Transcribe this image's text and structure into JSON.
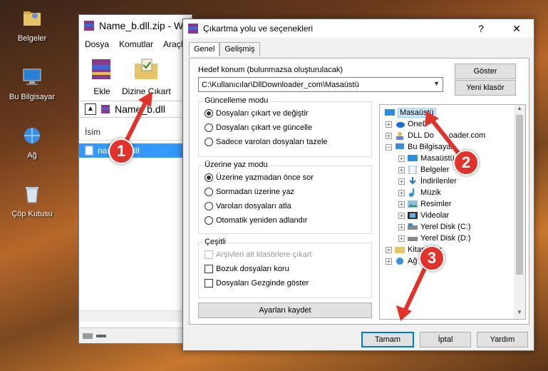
{
  "desktop": {
    "icons": [
      {
        "label": "Belgeler",
        "icon": "folder-user-icon"
      },
      {
        "label": "Bu Bilgisayar",
        "icon": "computer-icon"
      },
      {
        "label": "Ağ",
        "icon": "network-icon"
      },
      {
        "label": "Çöp Kutusu",
        "icon": "recycle-bin-icon"
      }
    ]
  },
  "winrar": {
    "title": "Name_b.dll.zip - Wi",
    "menu": [
      "Dosya",
      "Komutlar",
      "Araçla"
    ],
    "tools": {
      "add": "Ekle",
      "extract": "Dizine Çıkart"
    },
    "address": "Name_b.dll",
    "column_name": "İsim",
    "file_row": "name_b.dll"
  },
  "dialog": {
    "title": "Çıkartma yolu ve seçenekleri",
    "help_button": "?",
    "close_button": "✕",
    "tabs": [
      "Genel",
      "Gelişmiş"
    ],
    "dest_label": "Hedef konum (bulunmazsa oluşturulacak)",
    "dest_value": "C:\\Kullanıcılar\\DllDownloader_com\\Masaüstü",
    "show_button": "Göster",
    "new_folder_button": "Yeni klasör",
    "update_mode": {
      "title": "Güncelleme modu",
      "options": [
        "Dosyaları çıkart ve değiştir",
        "Dosyaları çıkart ve güncelle",
        "Sadece varolan dosyaları tazele"
      ],
      "selected": 0
    },
    "overwrite_mode": {
      "title": "Üzerine yaz modu",
      "options": [
        "Üzerine yazmadan önce sor",
        "Sormadan üzerine yaz",
        "Varolan dosyaları atla",
        "Otomatik yeniden adlandır"
      ],
      "selected": 0
    },
    "misc": {
      "title": "Çeşitli",
      "options": [
        "Arşivleri alt klasörlere çıkart",
        "Bozuk dosyaları koru",
        "Dosyaları Gezginde göster"
      ],
      "disabled": [
        true,
        false,
        false
      ]
    },
    "save_button": "Ayarları kaydet",
    "tree": [
      {
        "label": "Masaüstü",
        "icon": "desktop-icon"
      },
      {
        "label": "OneD",
        "icon": "cloud-icon"
      },
      {
        "label": "DLL Do",
        "icon": "user-icon"
      },
      {
        "label": "oader.com",
        "icon": "text-fragment"
      },
      {
        "label": "Bu Bilgisayar",
        "icon": "computer-icon"
      },
      {
        "label": "Masaüstü",
        "icon": "desktop-icon"
      },
      {
        "label": "Belgeler",
        "icon": "documents-icon"
      },
      {
        "label": "İndirilenler",
        "icon": "download-icon"
      },
      {
        "label": "Müzik",
        "icon": "music-icon"
      },
      {
        "label": "Resimler",
        "icon": "pictures-icon"
      },
      {
        "label": "Videolar",
        "icon": "video-icon"
      },
      {
        "label": "Yerel Disk (C:)",
        "icon": "drive-icon"
      },
      {
        "label": "Yerel Disk (D:)",
        "icon": "drive-icon"
      },
      {
        "label": "Kitaplıklar",
        "icon": "library-icon"
      },
      {
        "label": "Ağ",
        "icon": "network-icon"
      }
    ],
    "ok_button": "Tamam",
    "cancel_button": "İptal",
    "help_text_button": "Yardım"
  },
  "annotations": {
    "step1": "1",
    "step2": "2",
    "step3": "3",
    "color": "#e0332c"
  }
}
